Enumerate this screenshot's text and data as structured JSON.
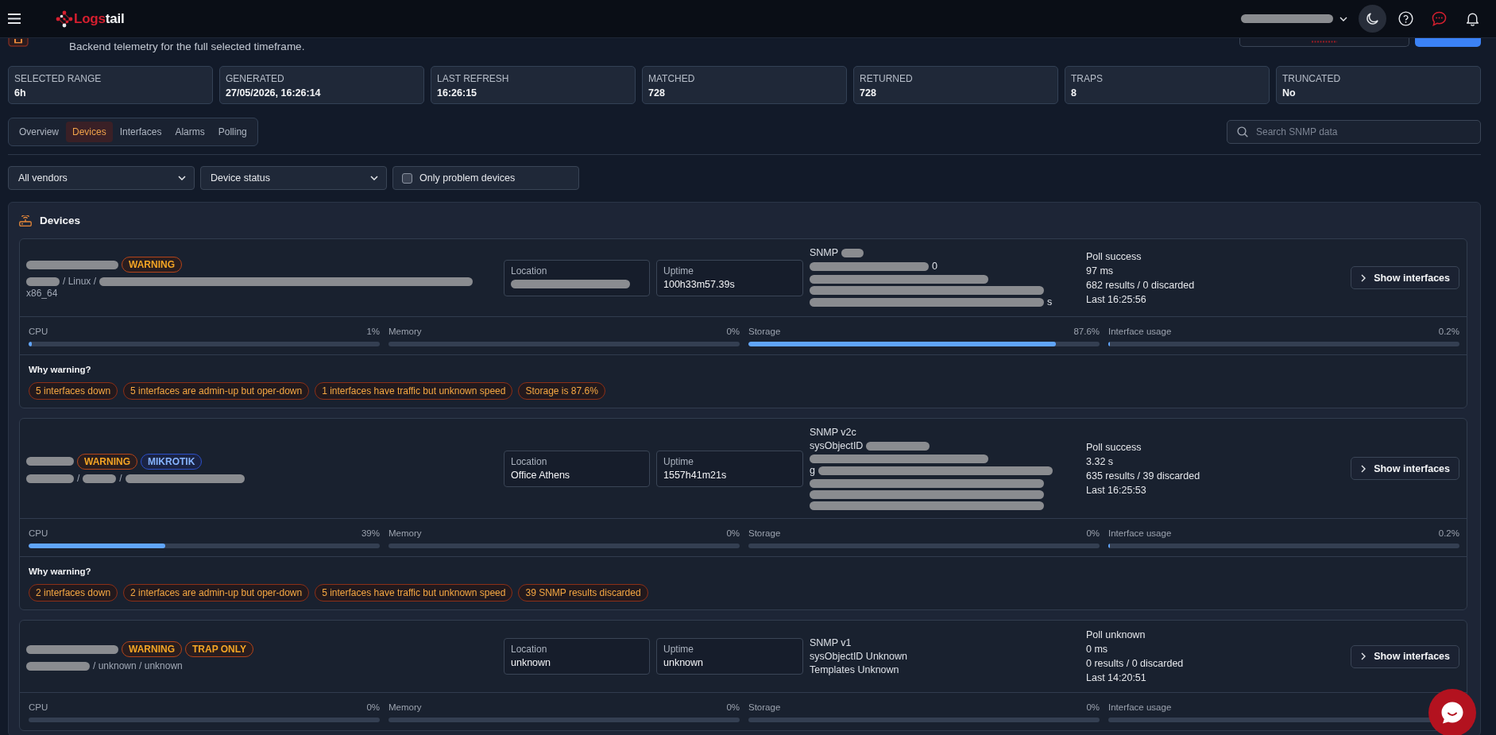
{
  "header": {
    "logo": [
      "Logs",
      "tail"
    ],
    "user": [
      {
        "kind": "blur-medium"
      }
    ]
  },
  "page": {
    "subtitle": "Backend telemetry for the full selected timeframe."
  },
  "stats": [
    {
      "label": "SELECTED RANGE",
      "value": "6h"
    },
    {
      "label": "GENERATED",
      "value": "27/05/2026, 16:26:14"
    },
    {
      "label": "LAST REFRESH",
      "value": "16:26:15"
    },
    {
      "label": "MATCHED",
      "value": "728"
    },
    {
      "label": "RETURNED",
      "value": "728"
    },
    {
      "label": "TRAPS",
      "value": "8"
    },
    {
      "label": "TRUNCATED",
      "value": "No"
    }
  ],
  "tabs": [
    {
      "label": "Overview",
      "selected": false
    },
    {
      "label": "Devices",
      "selected": true
    },
    {
      "label": "Interfaces",
      "selected": false
    },
    {
      "label": "Alarms",
      "selected": false
    },
    {
      "label": "Polling",
      "selected": false
    }
  ],
  "search": {
    "placeholder": "Search SNMP data"
  },
  "filters": {
    "selects": [
      {
        "value": "All vendors"
      },
      {
        "value": "Device status"
      }
    ],
    "checkbox": {
      "label": "Only problem devices",
      "checked": false
    }
  },
  "devices_panel": {
    "title": "Devices",
    "devices": [
      {
        "name": [
          {
            "kind": "blur-medium"
          }
        ],
        "badges": [
          {
            "label": "WARNING",
            "kind": "status"
          }
        ],
        "platform": [
          [
            {
              "kind": "blur-short"
            },
            {
              "kind": "text",
              "text": "/ Linux /"
            },
            {
              "kind": "blur-full"
            }
          ],
          [
            {
              "kind": "text",
              "text": "x86_64"
            }
          ]
        ],
        "fields": [
          {
            "label": "Location",
            "value": [
              {
                "kind": "blur-wide"
              }
            ]
          },
          {
            "label": "Uptime",
            "value": [
              {
                "kind": "text",
                "text": "100h33m57.39s"
              }
            ]
          }
        ],
        "snmp": [
          [
            {
              "kind": "text",
              "text": "SNMP"
            },
            {
              "kind": "blur-tiny"
            }
          ],
          [
            {
              "kind": "blur-wide"
            },
            {
              "kind": "text",
              "text": "0"
            }
          ],
          [
            {
              "kind": "blur-long"
            }
          ],
          [
            {
              "kind": "blur-xlong"
            }
          ],
          [
            {
              "kind": "blur-xlong"
            },
            {
              "kind": "text",
              "text": "s"
            }
          ]
        ],
        "poll": [
          "Poll success",
          "97 ms",
          "682 results / 0 discarded",
          "Last 16:25:56"
        ],
        "action": "Show interfaces",
        "metrics": [
          {
            "label": "CPU",
            "reading": "1%",
            "level": 0.01
          },
          {
            "label": "Memory",
            "reading": "0%"
          },
          {
            "label": "Storage",
            "reading": "87.6%",
            "level": 0.876
          },
          {
            "label": "Interface usage",
            "reading": "0.2%",
            "level": 0.002
          }
        ],
        "why": {
          "title": "Why warning?",
          "reasons": [
            "5 interfaces down",
            "5 interfaces are admin-up but oper-down",
            "1 interfaces have traffic but unknown speed",
            "Storage is 87.6%"
          ]
        }
      },
      {
        "name": [
          {
            "kind": "blur-small"
          }
        ],
        "badges": [
          {
            "label": "WARNING",
            "kind": "status"
          },
          {
            "label": "MIKROTIK",
            "kind": "vendor"
          }
        ],
        "platform": [
          [
            {
              "kind": "blur-small"
            },
            {
              "kind": "text",
              "text": "/"
            },
            {
              "kind": "blur-short"
            },
            {
              "kind": "text",
              "text": "/"
            },
            {
              "kind": "blur-wide"
            }
          ]
        ],
        "fields": [
          {
            "label": "Location",
            "value": [
              {
                "kind": "text",
                "text": "Office Athens"
              }
            ]
          },
          {
            "label": "Uptime",
            "value": [
              {
                "kind": "text",
                "text": "1557h41m21s"
              }
            ]
          }
        ],
        "snmp": [
          [
            {
              "kind": "text",
              "text": "SNMP v2c"
            }
          ],
          [
            {
              "kind": "text",
              "text": "sysObjectID"
            },
            {
              "kind": "blur-compact"
            }
          ],
          [
            {
              "kind": "blur-long"
            }
          ],
          [
            {
              "kind": "text",
              "text": "g"
            },
            {
              "kind": "blur-xlong"
            }
          ],
          [
            {
              "kind": "blur-xlong"
            }
          ],
          [
            {
              "kind": "blur-xlong"
            }
          ],
          [
            {
              "kind": "blur-xlong"
            }
          ]
        ],
        "poll": [
          "Poll success",
          "3.32 s",
          "635 results / 39 discarded",
          "Last 16:25:53"
        ],
        "action": "Show interfaces",
        "metrics": [
          {
            "label": "CPU",
            "reading": "39%",
            "level": 0.39
          },
          {
            "label": "Memory",
            "reading": "0%"
          },
          {
            "label": "Storage",
            "reading": "0%"
          },
          {
            "label": "Interface usage",
            "reading": "0.2%",
            "level": 0.002
          }
        ],
        "why": {
          "title": "Why warning?",
          "reasons": [
            "2 interfaces down",
            "2 interfaces are admin-up but oper-down",
            "5 interfaces have traffic but unknown speed",
            "39 SNMP results discarded"
          ]
        }
      },
      {
        "name": [
          {
            "kind": "blur-medium"
          }
        ],
        "badges": [
          {
            "label": "WARNING",
            "kind": "status"
          },
          {
            "label": "TRAP ONLY",
            "kind": "mode"
          }
        ],
        "platform": [
          [
            {
              "kind": "blur-compact"
            },
            {
              "kind": "text",
              "text": "/ unknown / unknown"
            }
          ]
        ],
        "fields": [
          {
            "label": "Location",
            "value": [
              {
                "kind": "text",
                "text": "unknown"
              }
            ]
          },
          {
            "label": "Uptime",
            "value": [
              {
                "kind": "text",
                "text": "unknown"
              }
            ]
          }
        ],
        "snmp": [
          [
            {
              "kind": "text",
              "text": "SNMP v1"
            }
          ],
          [
            {
              "kind": "text",
              "text": "sysObjectID Unknown"
            }
          ],
          [
            {
              "kind": "text",
              "text": "Templates Unknown"
            }
          ]
        ],
        "poll": [
          "Poll unknown",
          "0 ms",
          "0 results / 0 discarded",
          "Last 14:20:51"
        ],
        "action": "Show interfaces",
        "metrics": [
          {
            "label": "CPU",
            "reading": "0%"
          },
          {
            "label": "Memory",
            "reading": "0%"
          },
          {
            "label": "Storage",
            "reading": "0%"
          },
          {
            "label": "Interface usage"
          }
        ]
      }
    ]
  }
}
